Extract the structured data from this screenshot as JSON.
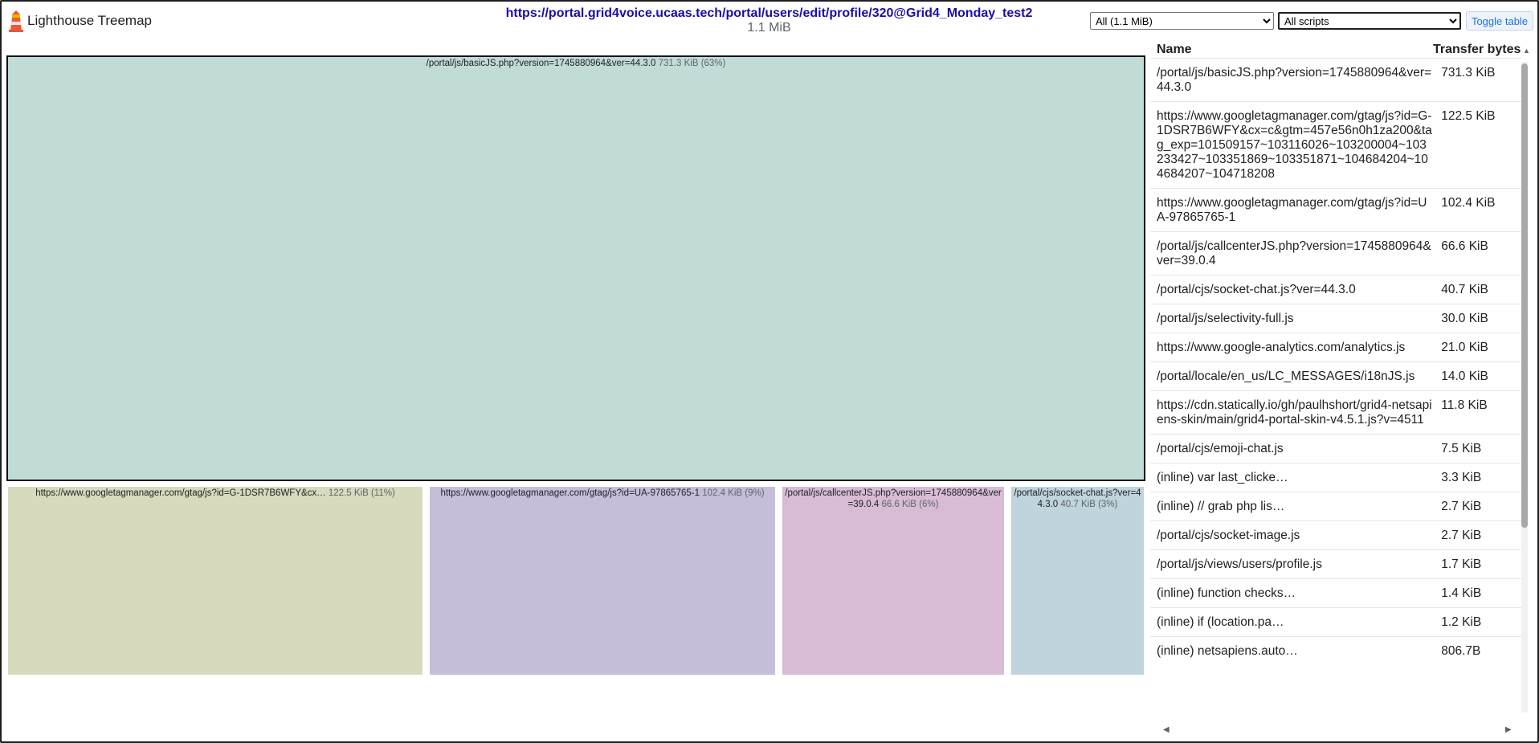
{
  "header": {
    "app_title": "Lighthouse Treemap",
    "page_url": "https://portal.grid4voice.ucaas.tech/portal/users/edit/profile/320@Grid4_Monday_test2",
    "page_size": "1.1 MiB",
    "view_select": "All (1.1 MiB)",
    "filter_select": "All scripts",
    "toggle_label": "Toggle table",
    "logo_icon": "lighthouse-icon"
  },
  "treemap": {
    "nodes": [
      {
        "label": "/portal/js/basicJS.php?version=1745880964&ver=44.3.0",
        "size": "731.3 KiB (63%)",
        "color": "#c1dcd7"
      },
      {
        "label": "https://www.googletagmanager.com/gtag/js?id=G-1DSR7B6WFY&cx…",
        "size": "122.5 KiB (11%)",
        "color": "#d7dabd"
      },
      {
        "label": "https://www.googletagmanager.com/gtag/js?id=UA-97865765-1",
        "size": "102.4 KiB (9%)",
        "color": "#c6bddb"
      },
      {
        "label": "/portal/js/callcenterJS.php?version=1745880964&ver=39.0.4",
        "size": "66.6 KiB (6%)",
        "color": "#d8bcd6"
      },
      {
        "label": "/portal/cjs/socket-chat.js?ver=44.3.0",
        "size": "40.7 KiB (3%)",
        "color": "#bfd4dc"
      }
    ]
  },
  "table": {
    "col_name": "Name",
    "col_bytes": "Transfer bytes",
    "rows": [
      {
        "name": "/portal/js/basicJS.php?version=1745880964&ver=44.3.0",
        "bytes": "731.3 KiB"
      },
      {
        "name": "https://www.googletagmanager.com/gtag/js?id=G-1DSR7B6WFY&cx=c&gtm=457e56n0h1za200&tag_exp=101509157~103116026~103200004~103233427~103351869~103351871~104684204~104684207~104718208",
        "bytes": "122.5 KiB"
      },
      {
        "name": "https://www.googletagmanager.com/gtag/js?id=UA-97865765-1",
        "bytes": "102.4 KiB"
      },
      {
        "name": "/portal/js/callcenterJS.php?version=1745880964&ver=39.0.4",
        "bytes": "66.6 KiB"
      },
      {
        "name": "/portal/cjs/socket-chat.js?ver=44.3.0",
        "bytes": "40.7 KiB"
      },
      {
        "name": "/portal/js/selectivity-full.js",
        "bytes": "30.0 KiB"
      },
      {
        "name": "https://www.google-analytics.com/analytics.js",
        "bytes": "21.0 KiB"
      },
      {
        "name": "/portal/locale/en_us/LC_MESSAGES/i18nJS.js",
        "bytes": "14.0 KiB"
      },
      {
        "name": "https://cdn.statically.io/gh/paulhshort/grid4-netsapiens-skin/main/grid4-portal-skin-v4.5.1.js?v=4511",
        "bytes": "11.8 KiB"
      },
      {
        "name": "/portal/cjs/emoji-chat.js",
        "bytes": "7.5 KiB"
      },
      {
        "name": "(inline) var last_clicke…",
        "bytes": "3.3 KiB"
      },
      {
        "name": "(inline) // grab php lis…",
        "bytes": "2.7 KiB"
      },
      {
        "name": "/portal/cjs/socket-image.js",
        "bytes": "2.7 KiB"
      },
      {
        "name": "/portal/js/views/users/profile.js",
        "bytes": "1.7 KiB"
      },
      {
        "name": "(inline) function checks…",
        "bytes": "1.4 KiB"
      },
      {
        "name": "(inline) if (location.pa…",
        "bytes": "1.2 KiB"
      },
      {
        "name": "(inline) netsapiens.auto…",
        "bytes": "806.7B"
      }
    ]
  }
}
